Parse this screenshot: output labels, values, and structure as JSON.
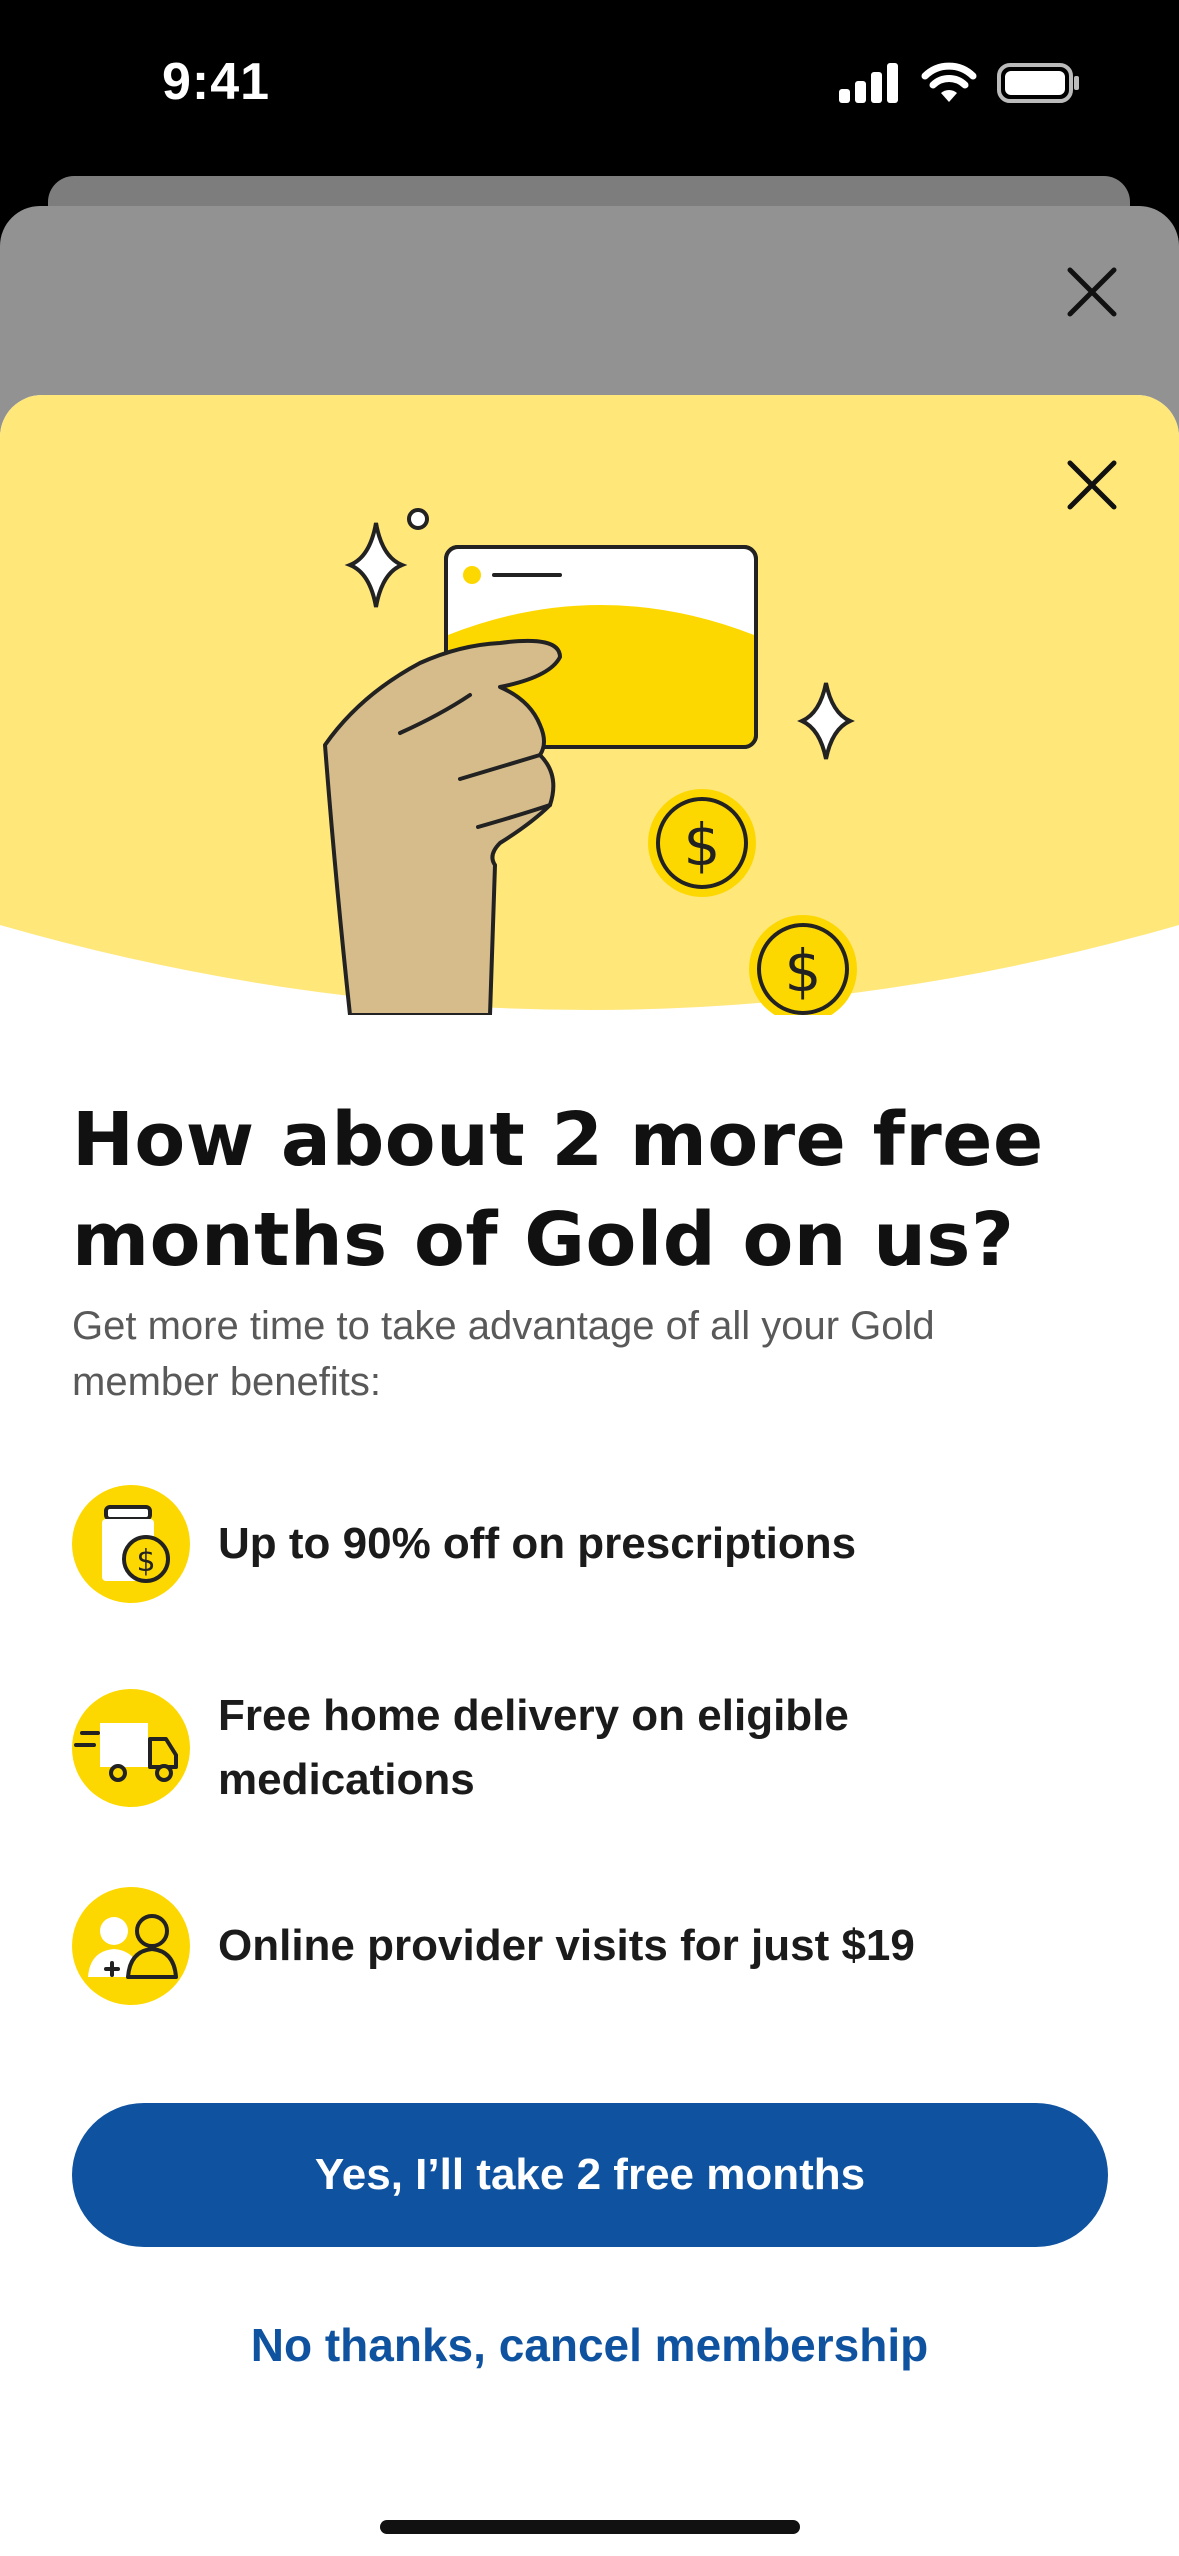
{
  "status": {
    "time": "9:41"
  },
  "modal": {
    "title": "How about 2 more free months of Gold on us?",
    "subtitle": "Get more time to take advantage of all your Gold member benefits:",
    "benefits": [
      {
        "icon": "prescription-discount-icon",
        "text": "Up to 90% off on prescriptions"
      },
      {
        "icon": "delivery-truck-icon",
        "text": "Free home delivery on eligible medications"
      },
      {
        "icon": "provider-visit-icon",
        "text": "Online provider visits for just $19"
      }
    ],
    "primary_button": "Yes, I’ll take 2 free months",
    "secondary_link": "No thanks, cancel membership"
  },
  "colors": {
    "accent_yellow": "#FDD800",
    "hero_background": "#FFE77A",
    "primary_blue": "#0F53A0",
    "skin": "#D6BC8B"
  }
}
